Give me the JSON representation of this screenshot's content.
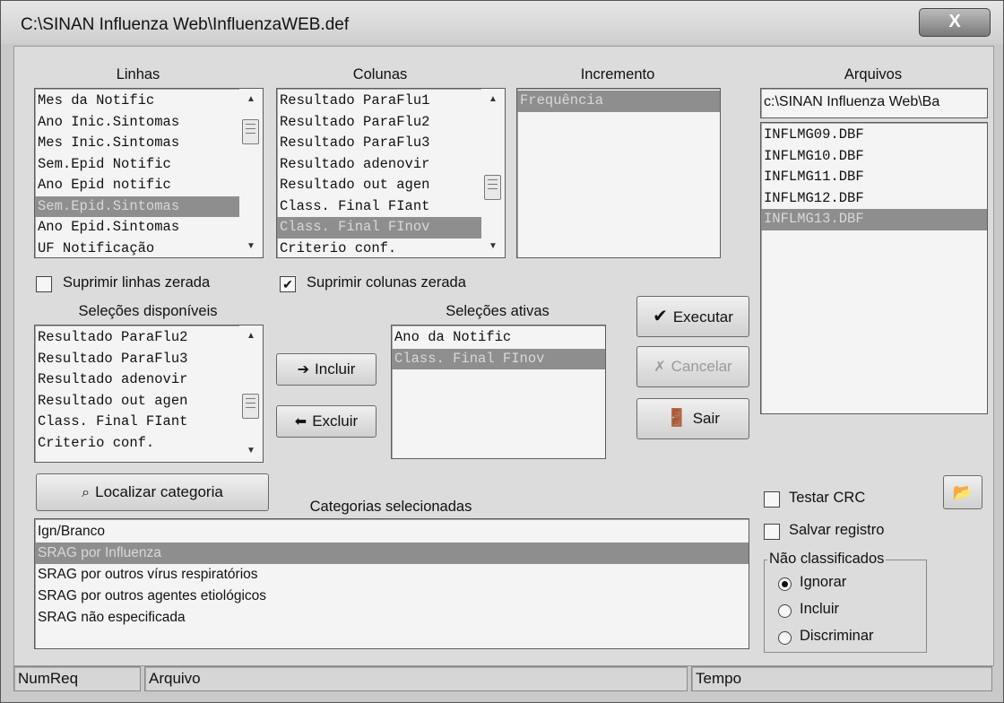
{
  "window": {
    "title": "C:\\SINAN Influenza Web\\InfluenzaWEB.def",
    "close_glyph": "X"
  },
  "linhas": {
    "label": "Linhas",
    "items": [
      "Mes da Notific",
      "Ano Inic.Sintomas",
      "Mes Inic.Sintomas",
      "Sem.Epid Notific",
      "Ano Epid notific",
      "Sem.Epid.Sintomas",
      "Ano Epid.Sintomas",
      "UF Notificação"
    ],
    "selected_index": 5
  },
  "colunas": {
    "label": "Colunas",
    "items": [
      "Resultado ParaFlu1",
      "Resultado ParaFlu2",
      "Resultado ParaFlu3",
      "Resultado adenovir",
      "Resultado out agen",
      "Class. Final FIant",
      "Class. Final FInov",
      "Criterio conf."
    ],
    "selected_index": 6
  },
  "incremento": {
    "label": "Incremento",
    "items": [
      "Frequência"
    ],
    "selected_index": 0
  },
  "arquivos": {
    "label": "Arquivos",
    "path_value": "c:\\SINAN Influenza Web\\Ba",
    "items": [
      "INFLMG09.DBF",
      "INFLMG10.DBF",
      "INFLMG11.DBF",
      "INFLMG12.DBF",
      "INFLMG13.DBF"
    ],
    "selected_index": 4
  },
  "suprimir_linhas": {
    "label": "Suprimir linhas zerada",
    "checked": false
  },
  "suprimir_colunas": {
    "label": "Suprimir colunas zerada",
    "checked": true
  },
  "selecoes_disponiveis": {
    "label": "Seleções disponíveis",
    "items": [
      "Resultado ParaFlu2",
      "Resultado ParaFlu3",
      "Resultado adenovir",
      "Resultado out agen",
      "Class. Final FIant",
      "Criterio conf."
    ]
  },
  "selecoes_ativas": {
    "label": "Seleções ativas",
    "items": [
      "Ano da Notific",
      "Class. Final FInov"
    ],
    "selected_index": 1
  },
  "buttons": {
    "incluir": "Incluir",
    "excluir": "Excluir",
    "executar": "Executar",
    "cancelar": "Cancelar",
    "sair": "Sair",
    "localizar": "Localizar categoria"
  },
  "categorias": {
    "label": "Categorias selecionadas",
    "items": [
      "Ign/Branco",
      "SRAG por Influenza",
      "SRAG por outros vírus respiratórios",
      "SRAG por outros agentes etiológicos",
      "SRAG não especificada"
    ],
    "selected_index": 1
  },
  "testar_crc": {
    "label": "Testar CRC",
    "checked": false
  },
  "salvar_registro": {
    "label": "Salvar registro",
    "checked": false
  },
  "nao_classificados": {
    "label": "Não classificados",
    "options": [
      "Ignorar",
      "Incluir",
      "Discriminar"
    ],
    "selected_index": 0
  },
  "status_bar": {
    "numreq": "NumReq",
    "arquivo": "Arquivo",
    "tempo": "Tempo"
  },
  "icons": {
    "open_folder": "folder-open-icon",
    "check": "checkmark-icon",
    "cancel": "x-icon",
    "exit": "door-exit-icon"
  },
  "colors": {
    "selection": "#8e8e8e",
    "window_bg": "#dcdcdc"
  }
}
